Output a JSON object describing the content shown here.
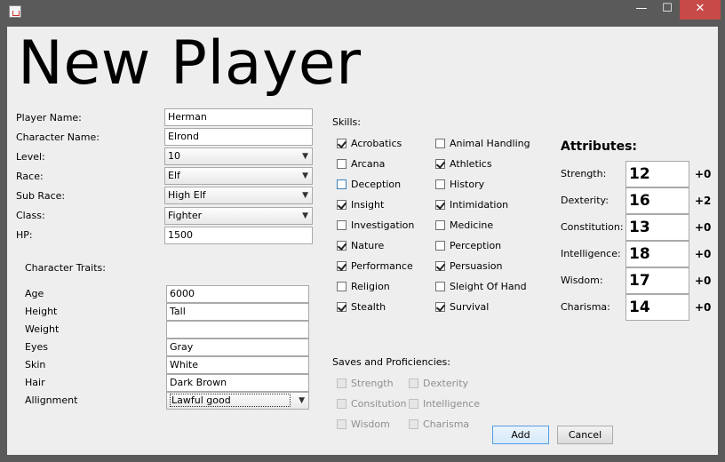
{
  "window": {
    "minimize_glyph": "—",
    "maximize_glyph": "☐",
    "close_glyph": "✕"
  },
  "title": "New Player",
  "player": {
    "name_label": "Player Name:",
    "name_value": "Herman",
    "character_label": "Character Name:",
    "character_value": "Elrond",
    "level_label": "Level:",
    "level_value": "10",
    "race_label": "Race:",
    "race_value": "Elf",
    "subrace_label": "Sub Race:",
    "subrace_value": "High Elf",
    "class_label": "Class:",
    "class_value": "Fighter",
    "hp_label": "HP:",
    "hp_value": "1500"
  },
  "traits": {
    "heading": "Character Traits:",
    "age_label": "Age",
    "age_value": "6000",
    "height_label": "Height",
    "height_value": "Tall",
    "weight_label": "Weight",
    "weight_value": "",
    "eyes_label": "Eyes",
    "eyes_value": "Gray",
    "skin_label": "Skin",
    "skin_value": "White",
    "hair_label": "Hair",
    "hair_value": "Dark Brown",
    "alignment_label": "Allignment",
    "alignment_value": "Lawful good"
  },
  "skills": {
    "heading": "Skills:",
    "items": [
      {
        "label": "Acrobatics",
        "checked": true
      },
      {
        "label": "Arcana",
        "checked": false
      },
      {
        "label": "Deception",
        "checked": false
      },
      {
        "label": "Insight",
        "checked": true
      },
      {
        "label": "Investigation",
        "checked": false
      },
      {
        "label": "Nature",
        "checked": true
      },
      {
        "label": "Performance",
        "checked": true
      },
      {
        "label": "Religion",
        "checked": false
      },
      {
        "label": "Stealth",
        "checked": true
      },
      {
        "label": "Animal Handling",
        "checked": false
      },
      {
        "label": "Athletics",
        "checked": true
      },
      {
        "label": "History",
        "checked": false
      },
      {
        "label": "Intimidation",
        "checked": true
      },
      {
        "label": "Medicine",
        "checked": false
      },
      {
        "label": "Perception",
        "checked": false
      },
      {
        "label": "Persuasion",
        "checked": true
      },
      {
        "label": "Sleight Of Hand",
        "checked": false
      },
      {
        "label": "Survival",
        "checked": true
      }
    ]
  },
  "saves": {
    "heading": "Saves and Proficiencies:",
    "items": [
      {
        "label": "Strength"
      },
      {
        "label": "Consitution"
      },
      {
        "label": "Wisdom"
      },
      {
        "label": "Dexterity"
      },
      {
        "label": "Intelligence"
      },
      {
        "label": "Charisma"
      }
    ]
  },
  "attributes": {
    "heading": "Attributes:",
    "items": [
      {
        "label": "Strength:",
        "value": "12",
        "modifier": "+0"
      },
      {
        "label": "Dexterity:",
        "value": "16",
        "modifier": "+2"
      },
      {
        "label": "Constitution:",
        "value": "13",
        "modifier": "+0"
      },
      {
        "label": "Intelligence:",
        "value": "18",
        "modifier": "+0"
      },
      {
        "label": "Wisdom:",
        "value": "17",
        "modifier": "+0"
      },
      {
        "label": "Charisma:",
        "value": "14",
        "modifier": "+0"
      }
    ]
  },
  "buttons": {
    "add": "Add",
    "cancel": "Cancel"
  },
  "icons": {
    "dropdown_arrow": "chevron-down-icon"
  }
}
